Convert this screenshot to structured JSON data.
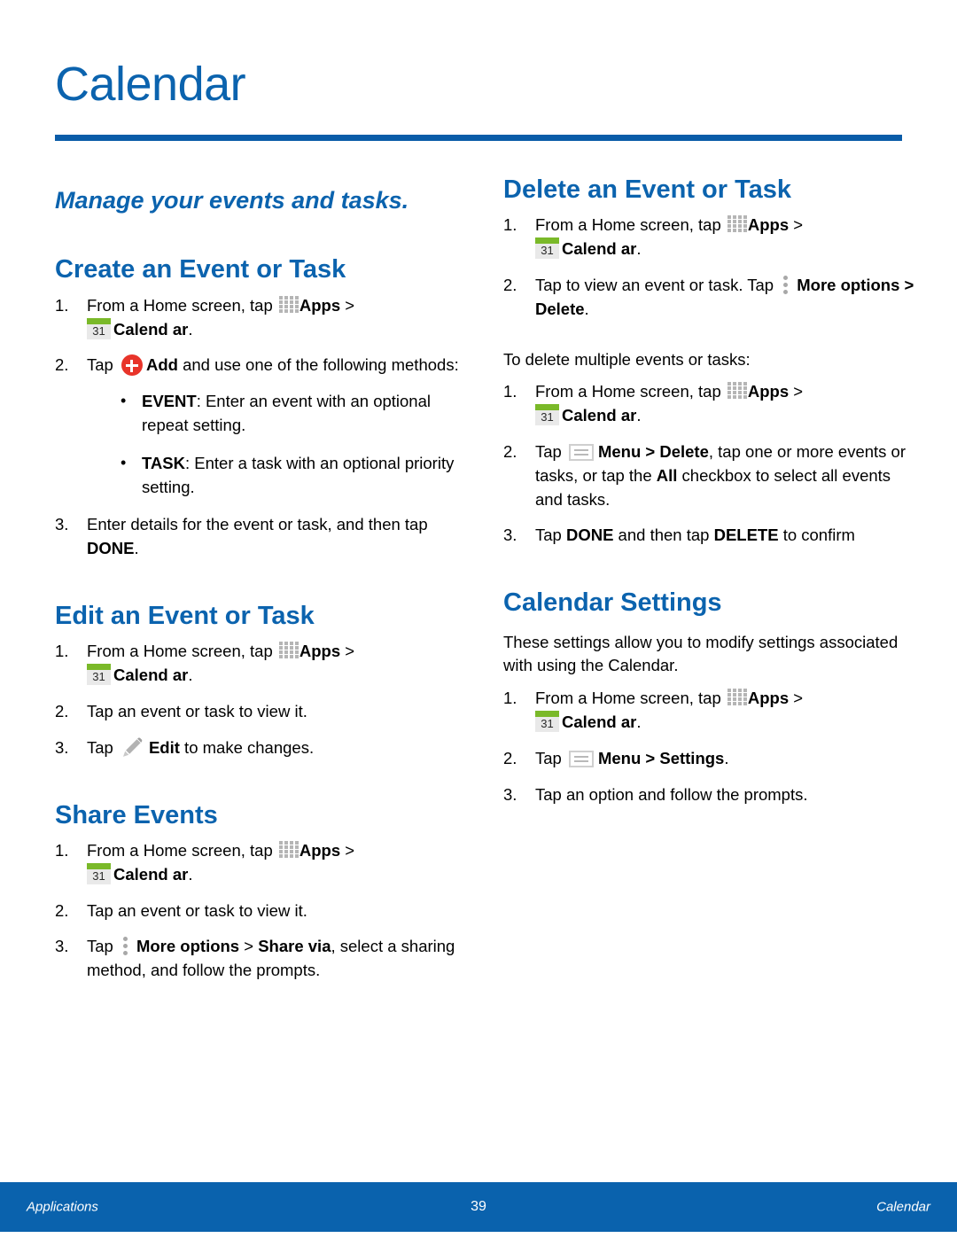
{
  "header": {
    "title": "Calendar",
    "tagline": "Manage your events and tasks."
  },
  "icons": {
    "apps": "apps-grid-icon",
    "calendar": "calendar-31-icon",
    "calendar_day": "31",
    "add": "add-plus-icon",
    "more_options": "more-options-icon",
    "menu": "menu-icon",
    "edit": "edit-pencil-icon"
  },
  "colors": {
    "heading_blue": "#0b63ae",
    "rule_blue": "#0a5ca8",
    "footer_blue": "#0a62ad",
    "calendar_icon_green": "#7ab929",
    "add_icon_red": "#e8342a",
    "icon_gray": "#b5b5b5"
  },
  "left_column": {
    "create": {
      "heading": "Create an Event or Task",
      "step1_a": "From a Home screen, tap ",
      "step1_apps": "Apps",
      "step1_gt": " > ",
      "step1_cal": "Calend ar",
      "step1_end": ".",
      "step2_a": "Tap ",
      "step2_add": "Add",
      "step2_b": " and use one of the following methods:",
      "bullet1_label": "EVENT",
      "bullet1_text": ": Enter an event with an optional repeat setting.",
      "bullet2_label": "TASK",
      "bullet2_text": ": Enter a task with an optional priority setting.",
      "step3_a": "Enter details for the event or task, and then tap ",
      "step3_done": "DONE",
      "step3_end": "."
    },
    "edit": {
      "heading": "Edit an Event or Task",
      "step1_a": "From a Home screen, tap ",
      "step1_apps": "Apps",
      "step1_gt": " > ",
      "step1_cal": "Calend ar",
      "step1_end": ".",
      "step2": "Tap an event or task to view it.",
      "step3_a": "Tap ",
      "step3_edit": "Edit",
      "step3_b": " to make changes."
    },
    "share": {
      "heading": "Share Events",
      "step1_a": "From a Home screen, tap ",
      "step1_apps": "Apps",
      "step1_gt": " > ",
      "step1_cal": "Calend ar",
      "step1_end": ".",
      "step2": "Tap an event or task to view it.",
      "step3_a": "Tap ",
      "step3_more": "More options",
      "step3_gt": " > ",
      "step3_share": "Share via",
      "step3_b": ", select a sharing method, and follow the prompts."
    }
  },
  "right_column": {
    "delete": {
      "heading": "Delete an Event or Task",
      "step1_a": "From a Home screen, tap ",
      "step1_apps": "Apps",
      "step1_gt": " > ",
      "step1_cal": "Calend ar",
      "step1_end": ".",
      "step2_a": "Tap to view an event or task. Tap ",
      "step2_more": "More options",
      "step2_b": " > ",
      "step2_delete": "Delete",
      "step2_end": ".",
      "multi_intro": "To delete multiple events or tasks:",
      "m_step1_a": "From a Home screen, tap ",
      "m_step1_apps": "Apps",
      "m_step1_gt": " > ",
      "m_step1_cal": "Calend ar",
      "m_step1_end": ".",
      "m_step2_a": "Tap ",
      "m_step2_menu": "Menu > Delete",
      "m_step2_b": ", tap one or more events or tasks, or tap the ",
      "m_step2_all": "All",
      "m_step2_c": " checkbox to select all events and tasks.",
      "m_step3_a": "Tap ",
      "m_step3_done": "DONE",
      "m_step3_b": " and then tap ",
      "m_step3_delete": "DELETE",
      "m_step3_c": " to confirm"
    },
    "settings": {
      "heading": "Calendar Settings",
      "intro": "These settings allow you to modify settings associated with using the Calendar.",
      "step1_a": "From a Home screen, tap ",
      "step1_apps": "Apps",
      "step1_gt": " > ",
      "step1_cal": "Calend ar",
      "step1_end": ".",
      "step2_a": "Tap ",
      "step2_menu": "Menu > Settings",
      "step2_end": ".",
      "step3": "Tap an option and follow the prompts."
    }
  },
  "numbers": {
    "n1": "1.",
    "n2": "2.",
    "n3": "3."
  },
  "footer": {
    "left": "Applications",
    "page": "39",
    "right": "Calendar"
  }
}
